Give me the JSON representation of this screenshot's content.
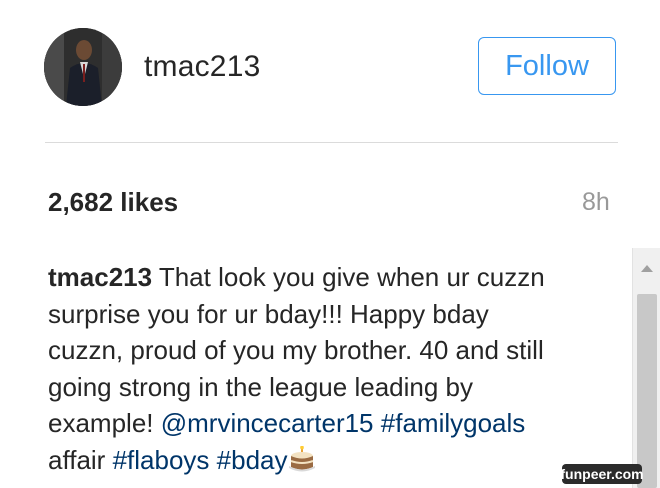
{
  "header": {
    "username": "tmac213",
    "follow_label": "Follow"
  },
  "post": {
    "likes": "2,682 likes",
    "time_ago": "8h",
    "caption": {
      "username": "tmac213",
      "text": "That look you give when ur cuzzn surprise you for ur bday!!! Happy bday cuzzn, proud of you my brother. 40 and still going strong in the league leading by example!",
      "mention": "@mrvincecarter15",
      "hashtag_1": "#familygoals",
      "word_affair": "affair",
      "hashtag_2": "#flaboys",
      "hashtag_3": "#bday",
      "emoji": "birthday-cake-icon"
    }
  },
  "watermark": "funpeer.com",
  "colors": {
    "accent": "#3897f0",
    "link": "#003569",
    "text": "#262626",
    "muted": "#999999"
  }
}
